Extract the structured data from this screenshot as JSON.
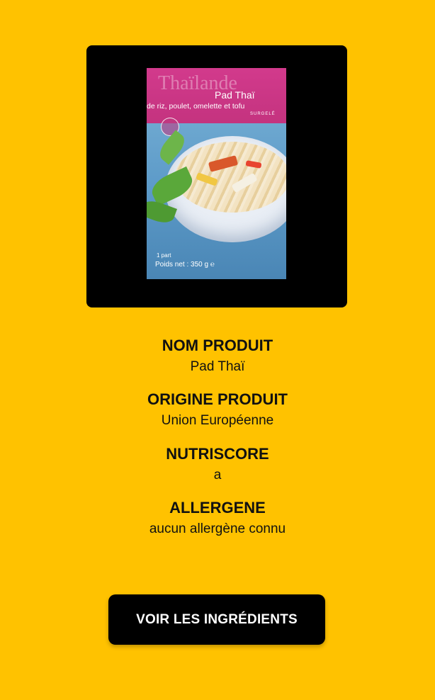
{
  "product_image": {
    "alt": "Pad Thaï",
    "pack": {
      "region": "Thaïlande",
      "name": "Pad Thaï",
      "description": "de riz, poulet, omelette et tofu",
      "tag": "SURGELÉ",
      "portion": "1 part",
      "weight": "Poids net : 350 g ℮"
    },
    "colors": {
      "card": "#000000",
      "band": "#C4337F"
    }
  },
  "info": {
    "nom": {
      "label": "NOM PRODUIT",
      "value": "Pad Thaï"
    },
    "origine": {
      "label": "ORIGINE PRODUIT",
      "value": "Union Européenne"
    },
    "nutriscore": {
      "label": "NUTRISCORE",
      "value": "a"
    },
    "allergene": {
      "label": "ALLERGENE",
      "value": "aucun allergène connu"
    }
  },
  "actions": {
    "ingredients_label": "VOIR LES INGRÉDIENTS"
  },
  "theme": {
    "background": "#FFC200",
    "button": "#000000",
    "text": "#111111"
  }
}
